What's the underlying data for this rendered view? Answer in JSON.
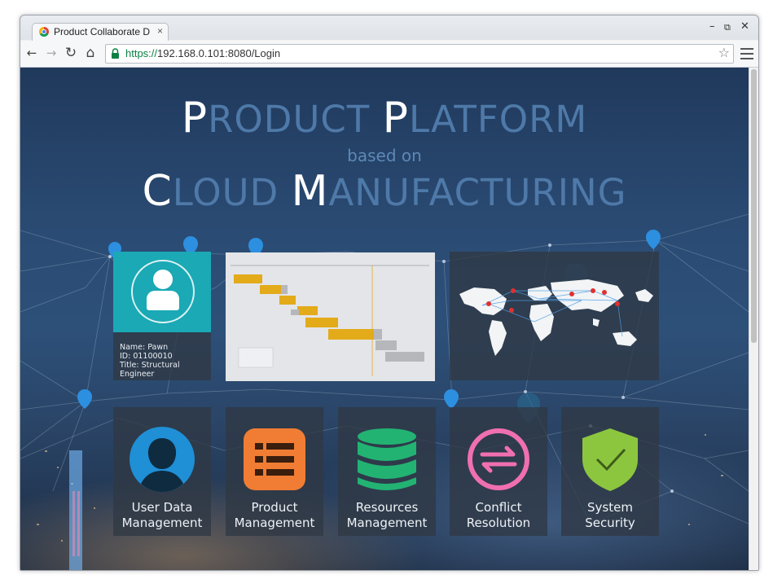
{
  "browser": {
    "tab_title": "Product Collaborate Des",
    "tab_close": "×",
    "url_scheme": "https://",
    "url_rest": "192.168.0.101:8080/Login",
    "minimize": "–",
    "restore": "⧉",
    "close": "✕",
    "back": "←",
    "forward": "→",
    "reload": "↻",
    "home": "⌂",
    "star": "☆"
  },
  "hero": {
    "line1_p": "P",
    "line1_rest1": "RODUCT ",
    "line1_p2": "P",
    "line1_rest2": "LATFORM",
    "line2": "based on",
    "line3_c": "C",
    "line3_rest1": "LOUD ",
    "line3_m": "M",
    "line3_rest2": "ANUFACTURING"
  },
  "profile": {
    "name": "Name: Pawn",
    "id": "ID: 01100010",
    "title": "Title: Structural Engineer"
  },
  "tiles": [
    {
      "line1": "User Data",
      "line2": "Management",
      "color": "#1f8fd6"
    },
    {
      "line1": "Product",
      "line2": "Management",
      "color": "#f07d33"
    },
    {
      "line1": "Resources",
      "line2": "Management",
      "color": "#22b373"
    },
    {
      "line1": "Conflict",
      "line2": "Resolution",
      "color": "#f06fb0"
    },
    {
      "line1": "System",
      "line2": "Security",
      "color": "#8cc63f"
    }
  ],
  "colors": {
    "profile_teal": "#1aa9b5",
    "gantt_bar": "#e3aa1a",
    "gantt_gray": "#b5b7bb",
    "pin_blue": "#2d8fe0"
  }
}
